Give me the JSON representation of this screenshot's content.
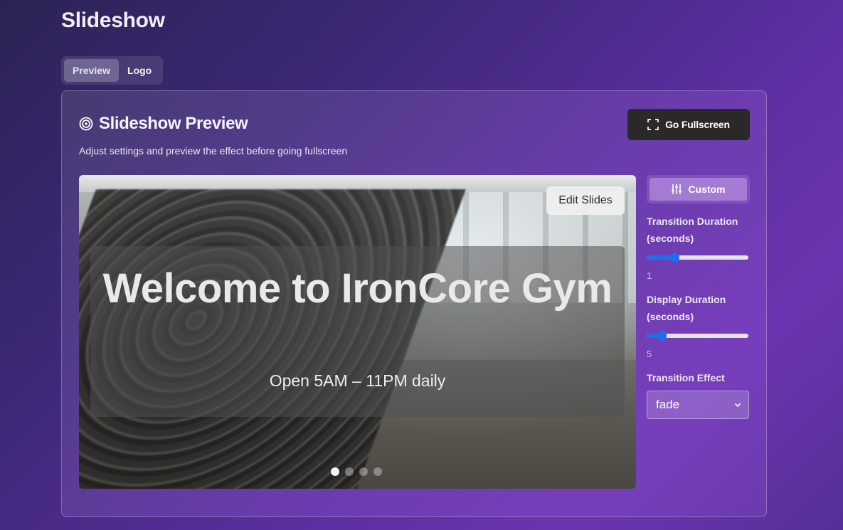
{
  "page": {
    "title": "Slideshow"
  },
  "tabs": [
    {
      "label": "Preview",
      "active": true
    },
    {
      "label": "Logo",
      "active": false
    }
  ],
  "card": {
    "title": "Slideshow Preview",
    "title_icon": "target-icon",
    "subtitle": "Adjust settings and preview the effect before going fullscreen",
    "fullscreen_button": {
      "label": "Go Fullscreen",
      "icon": "fullscreen-icon"
    }
  },
  "preview": {
    "edit_button": "Edit Slides",
    "headline": "Welcome to IronCore Gym",
    "subline": "Open 5AM – 11PM daily",
    "slide_count": 4,
    "active_slide": 1
  },
  "settings": {
    "preset_button": {
      "label": "Custom",
      "icon": "sliders-icon"
    },
    "transition_duration": {
      "label": "Transition Duration (seconds)",
      "value": "1",
      "fraction": 0.25
    },
    "display_duration": {
      "label": "Display Duration (seconds)",
      "value": "5",
      "fraction": 0.11
    },
    "transition_effect": {
      "label": "Transition Effect",
      "value": "fade"
    }
  },
  "colors": {
    "accent": "#1a6ef0",
    "button_dark": "#2a2828"
  }
}
